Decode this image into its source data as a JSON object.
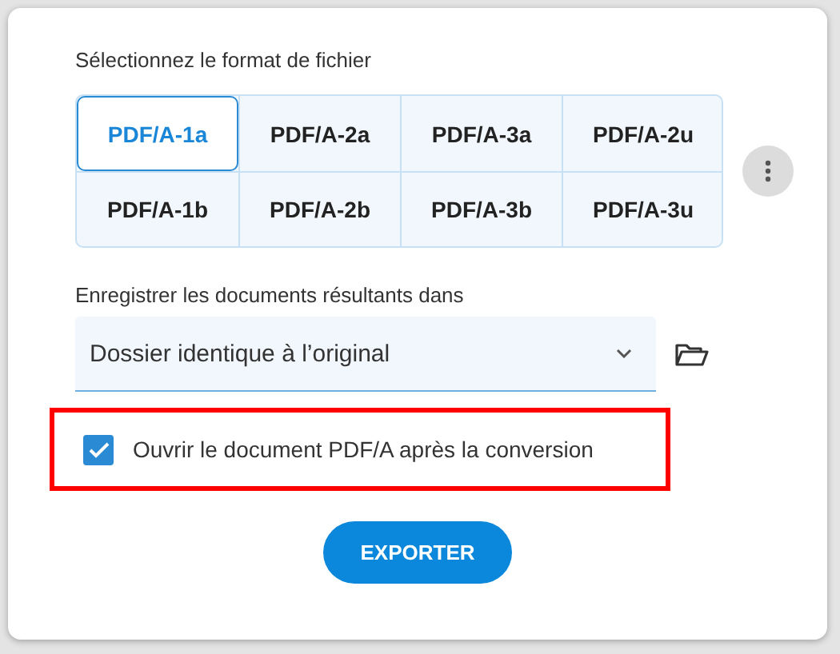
{
  "dialog": {
    "format_label": "Sélectionnez le format de fichier",
    "formats": [
      {
        "label": "PDF/A-1a",
        "selected": true
      },
      {
        "label": "PDF/A-2a",
        "selected": false
      },
      {
        "label": "PDF/A-3a",
        "selected": false
      },
      {
        "label": "PDF/A-2u",
        "selected": false
      },
      {
        "label": "PDF/A-1b",
        "selected": false
      },
      {
        "label": "PDF/A-2b",
        "selected": false
      },
      {
        "label": "PDF/A-3b",
        "selected": false
      },
      {
        "label": "PDF/A-3u",
        "selected": false
      }
    ],
    "save_label": "Enregistrer les documents résultants dans",
    "destination": {
      "value": "Dossier identique à l’original"
    },
    "open_after": {
      "label": "Ouvrir le document PDF/A après la conversion",
      "checked": true,
      "highlighted": true
    },
    "export_button": "EXPORTER"
  }
}
